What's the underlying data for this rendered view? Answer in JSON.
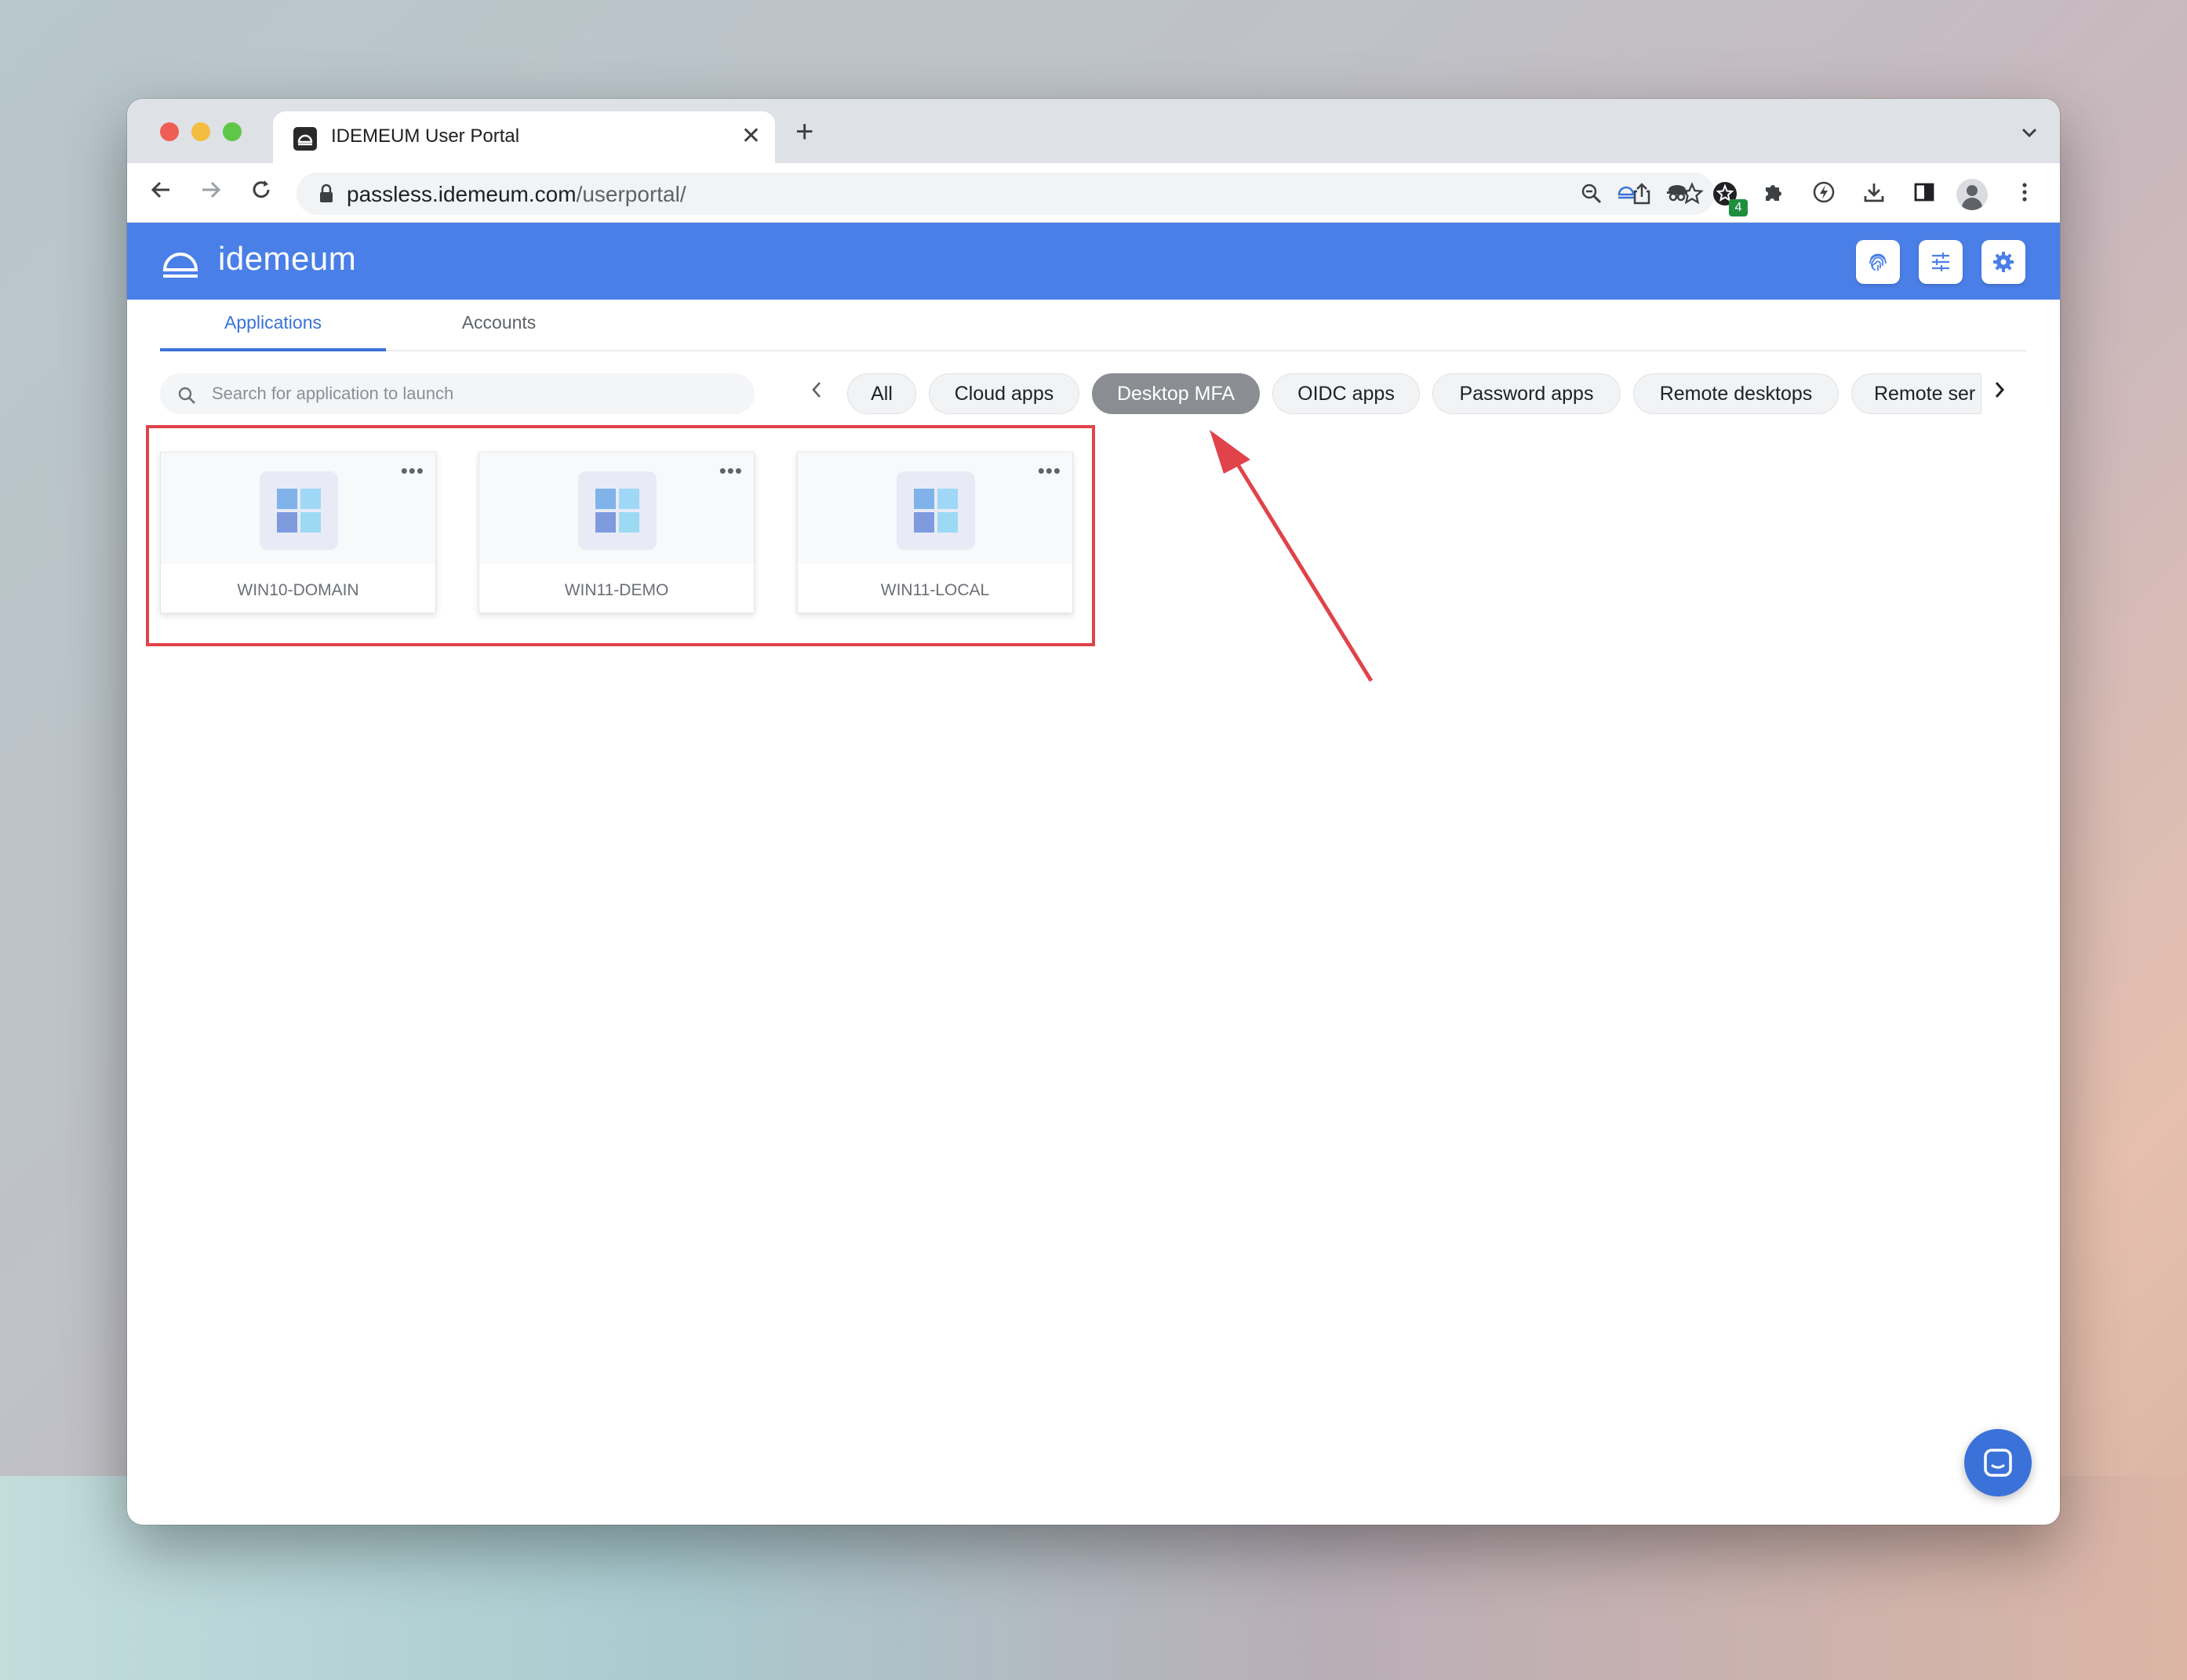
{
  "browser": {
    "tab_title": "IDEMEUM User Portal",
    "tab_close": "✕",
    "new_tab": "+",
    "tab_list": "⌄",
    "url_host": "passless.idemeum.com",
    "url_path": "/userportal/",
    "extension_badge": "4"
  },
  "app": {
    "logo_text": "idemeum"
  },
  "nav": {
    "tabs": [
      "Applications",
      "Accounts"
    ],
    "active": "Applications"
  },
  "search": {
    "placeholder": "Search for application to launch",
    "value": ""
  },
  "filters": {
    "chips": [
      "All",
      "Cloud apps",
      "Desktop MFA",
      "OIDC apps",
      "Password apps",
      "Remote desktops",
      "Remote ser"
    ],
    "selected": "Desktop MFA"
  },
  "applications": [
    {
      "name": "WIN10-DOMAIN",
      "icon": "windows-icon"
    },
    {
      "name": "WIN11-DEMO",
      "icon": "windows-icon"
    },
    {
      "name": "WIN11-LOCAL",
      "icon": "windows-icon"
    }
  ],
  "colors": {
    "brand": "#4a7fe8",
    "accent": "#3b72d9",
    "annotation": "#e0434a"
  }
}
